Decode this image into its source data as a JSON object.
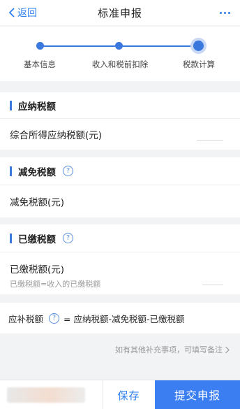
{
  "header": {
    "back_label": "返回",
    "title": "标准申报",
    "back_icon": "chevron-left-icon",
    "more_icon": "more-dots-icon"
  },
  "stepper": {
    "steps": [
      {
        "label": "基本信息",
        "state": "done"
      },
      {
        "label": "收入和税前扣除",
        "state": "done"
      },
      {
        "label": "税款计算",
        "state": "current"
      }
    ]
  },
  "sections": {
    "payable": {
      "title": "应纳税额",
      "row_label": "综合所得应纳税额(元)"
    },
    "reduction": {
      "title": "减免税额",
      "row_label": "减免税额(元)",
      "help_icon": "question-circle-icon"
    },
    "paid": {
      "title": "已缴税额",
      "row_label": "已缴税额(元)",
      "row_hint": "已缴税额=收入的已缴税额",
      "help_icon": "question-circle-icon"
    }
  },
  "formula": {
    "label": "应补税额",
    "expression": "= 应纳税额-减免税额-已缴税额",
    "help_icon": "question-circle-icon"
  },
  "note": {
    "text": "如有其他补充事项，可填写备注",
    "icon": "chevron-right-icon"
  },
  "bottom_bar": {
    "save_label": "保存",
    "submit_label": "提交申报"
  },
  "colors": {
    "accent": "#3b7ef2",
    "link": "#2d7ff0",
    "background": "#f2f3f5"
  }
}
